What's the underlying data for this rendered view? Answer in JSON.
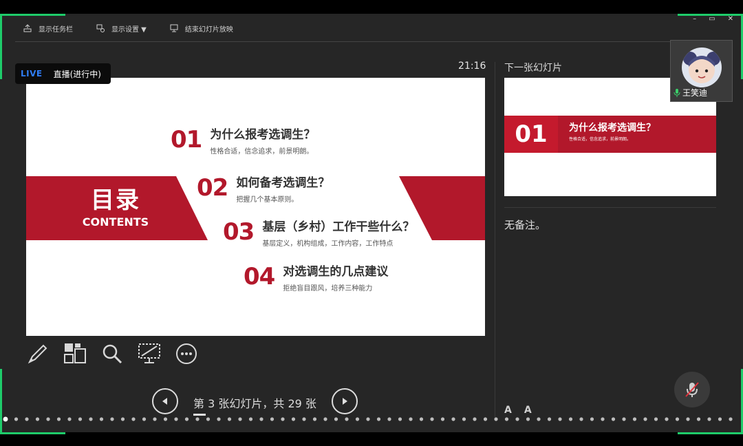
{
  "topbar": {
    "taskbar_label": "显示任务栏",
    "display_settings_label": "显示设置 ▼",
    "end_show_label": "结束幻灯片放映"
  },
  "window_controls": [
    "–",
    "▭",
    "✕"
  ],
  "live_badge": {
    "tag": "LIVE",
    "status": "直播(进行中)"
  },
  "clock": "21:16",
  "current_slide": {
    "toc_title": "目录",
    "toc_subtitle": "CONTENTS",
    "items": [
      {
        "num": "01",
        "title": "为什么报考选调生？",
        "desc": "性格合适，信念追求，前景明朗。"
      },
      {
        "num": "02",
        "title": "如何备考选调生？",
        "desc": "把握几个基本原则。"
      },
      {
        "num": "03",
        "title": "基层（乡村）工作干些什么？",
        "desc": "基层定义，机构组成，工作内容，工作特点"
      },
      {
        "num": "04",
        "title": "对选调生的几点建议",
        "desc": "拒绝盲目跟风，培养三种能力"
      }
    ]
  },
  "next_slide": {
    "label": "下一张幻灯片",
    "num": "01",
    "title": "为什么报考选调生？",
    "desc": "性格合适，信念追求，前景明朗。"
  },
  "notes": "无备注。",
  "navigation": {
    "counter": "第 3 张幻灯片，共 29 张"
  },
  "font_buttons": [
    "A",
    "A"
  ],
  "participant": {
    "name": "王笑迪"
  },
  "colors": {
    "accent_red": "#b2182b",
    "live_blue": "#2f7df6",
    "frame_green": "#1ecc6a"
  },
  "icons": [
    "pen-icon",
    "see-all-slides-icon",
    "zoom-icon",
    "black-screen-icon",
    "more-options-icon",
    "prev-slide-icon",
    "next-slide-icon",
    "mic-muted-icon"
  ]
}
